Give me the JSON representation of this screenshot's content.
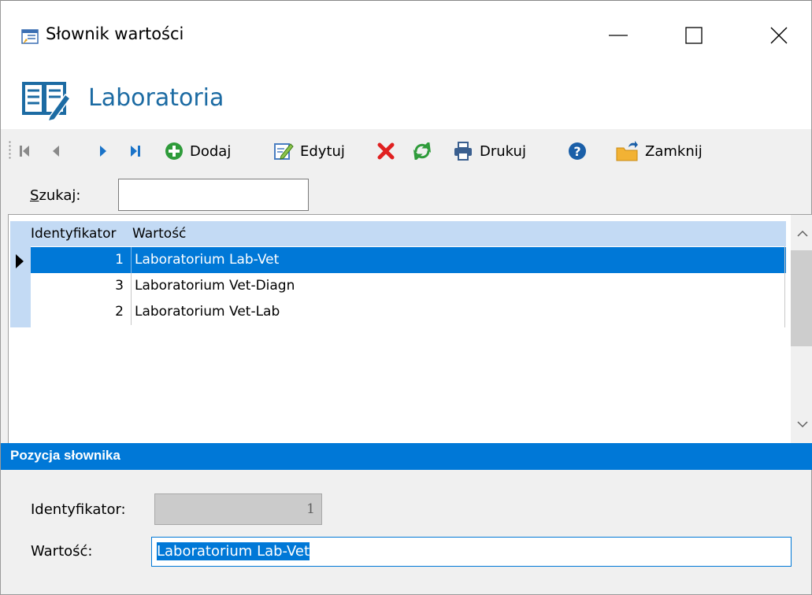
{
  "window": {
    "title": "Słownik wartości",
    "controls": {
      "minimize": "minimize-icon",
      "maximize": "maximize-icon",
      "close": "close-icon"
    }
  },
  "header": {
    "title": "Laboratoria",
    "icon": "dictionary-edit-icon"
  },
  "toolbar": {
    "first_icon": "first-record-icon",
    "prev_icon": "previous-record-icon",
    "next_icon": "next-record-icon",
    "last_icon": "last-record-icon",
    "add_label": "Dodaj",
    "edit_label": "Edytuj",
    "delete_icon": "delete-icon",
    "refresh_icon": "refresh-icon",
    "print_label": "Drukuj",
    "help_icon": "help-icon",
    "close_label": "Zamknij"
  },
  "search": {
    "label_accel": "S",
    "label_rest": "zukaj:",
    "value": ""
  },
  "grid": {
    "columns": [
      "Identyfikator",
      "Wartość"
    ],
    "rows": [
      {
        "id": "1",
        "value": "Laboratorium Lab-Vet",
        "selected": true
      },
      {
        "id": "3",
        "value": "Laboratorium Vet-Diagn",
        "selected": false
      },
      {
        "id": "2",
        "value": "Laboratorium Vet-Lab",
        "selected": false
      }
    ]
  },
  "detail": {
    "section_title": "Pozycja słownika",
    "id_label": "Identyfikator:",
    "id_value": "1",
    "value_label": "Wartość:",
    "value_value": "Laboratorium Lab-Vet"
  },
  "colors": {
    "accent": "#0078d7",
    "header_text": "#1c6ba3",
    "grid_header": "#c3daf4"
  }
}
